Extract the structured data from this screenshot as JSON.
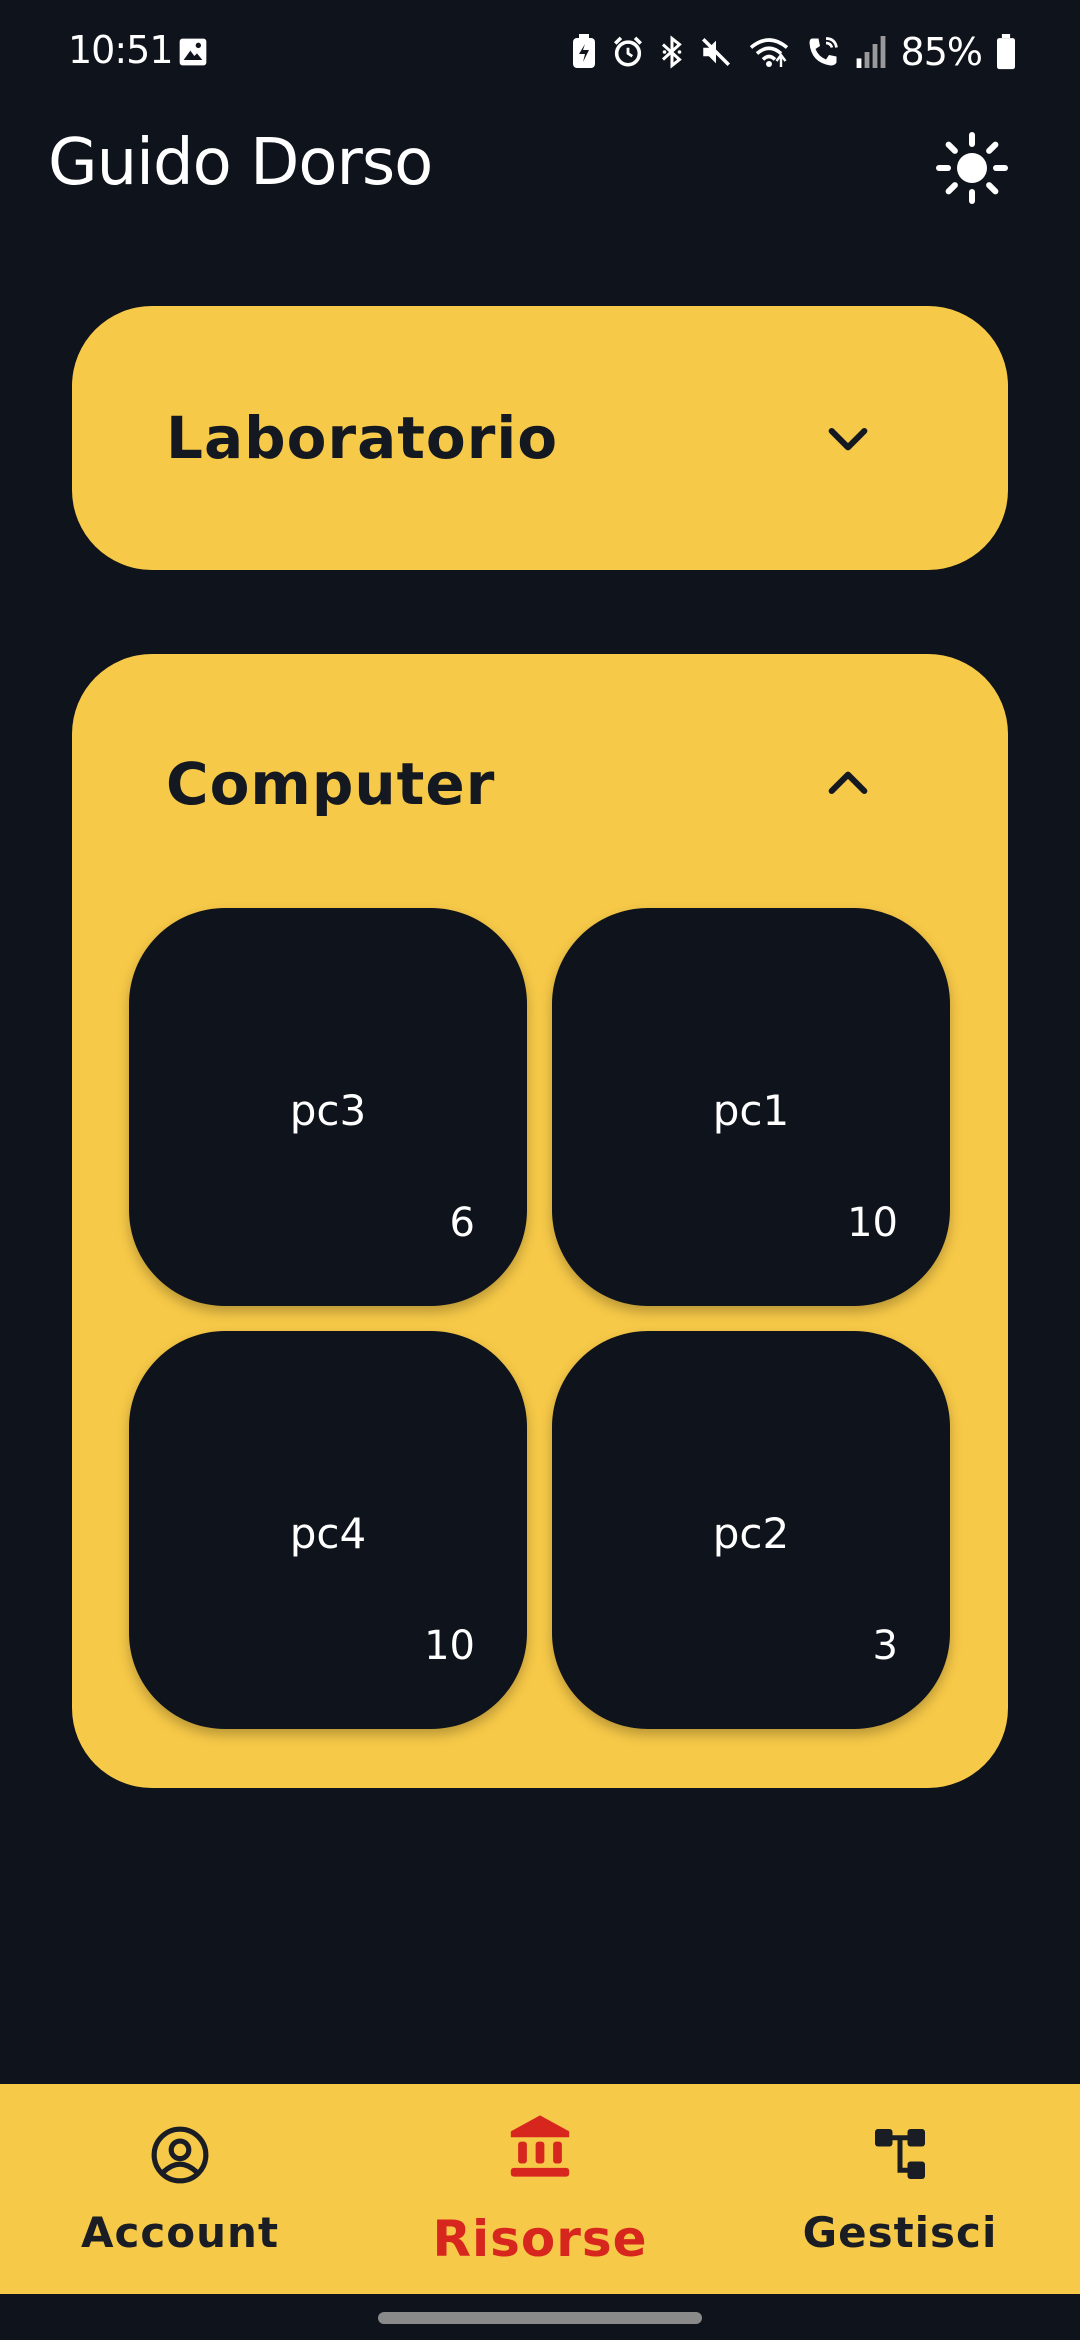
{
  "status_bar": {
    "time": "10:51",
    "battery_percent": "85%",
    "icons": [
      "gallery-icon",
      "battery-saver-icon",
      "alarm-icon",
      "bluetooth-icon",
      "mute-icon",
      "wifi-icon",
      "wifi-call-icon",
      "signal-icon",
      "battery-icon"
    ]
  },
  "header": {
    "title": "Guido Dorso",
    "theme_icon": "sun-icon"
  },
  "sections": [
    {
      "title": "Laboratorio",
      "expanded": false,
      "items": []
    },
    {
      "title": "Computer",
      "expanded": true,
      "items": [
        {
          "name": "pc3",
          "count": "6"
        },
        {
          "name": "pc1",
          "count": "10"
        },
        {
          "name": "pc4",
          "count": "10"
        },
        {
          "name": "pc2",
          "count": "3"
        }
      ]
    }
  ],
  "bottom_nav": {
    "items": [
      {
        "label": "Account",
        "icon": "account-circle-icon",
        "active": false
      },
      {
        "label": "Risorse",
        "icon": "bank-icon",
        "active": true
      },
      {
        "label": "Gestisci",
        "icon": "hierarchy-icon",
        "active": false
      }
    ]
  },
  "colors": {
    "background": "#0f131b",
    "accent_yellow": "#f7c948",
    "active_red": "#d7261e",
    "text_dark": "#141820",
    "text_light": "#ffffff"
  }
}
